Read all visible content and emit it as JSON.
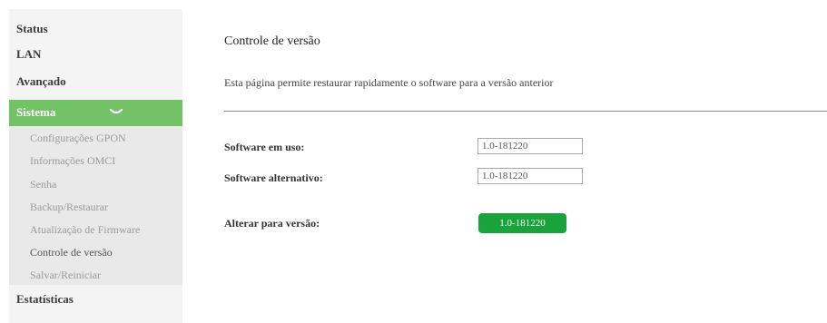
{
  "sidebar": {
    "top_items": [
      {
        "label": "Status"
      },
      {
        "label": "LAN"
      },
      {
        "label": "Avançado"
      }
    ],
    "sistema": {
      "label": "Sistema",
      "expanded": true
    },
    "sub_items": [
      {
        "label": "Configurações GPON"
      },
      {
        "label": "Informações OMCI"
      },
      {
        "label": "Senha"
      },
      {
        "label": "Backup/Restaurar"
      },
      {
        "label": "Atualização de Firmware"
      },
      {
        "label": "Controle de versão",
        "active": true
      },
      {
        "label": "Salvar/Reiniciar"
      }
    ],
    "bottom_items": [
      {
        "label": "Estatísticas"
      }
    ]
  },
  "main": {
    "title": "Controle de versão",
    "description": "Esta página permite restaurar rapidamente o software para a versão anterior",
    "software_in_use": {
      "label": "Software em uso:",
      "value": "1.0-181220"
    },
    "software_alternative": {
      "label": "Software alternativo:",
      "value": "1.0-181220"
    },
    "switch_version": {
      "label": "Alterar para versão:",
      "button": "1.0-181220"
    }
  },
  "colors": {
    "menu_active_bg": "#74c266",
    "button_bg": "#1aa33a",
    "sidebar_bg": "#f4f4f4",
    "submenu_bg": "#e9e9e9"
  }
}
